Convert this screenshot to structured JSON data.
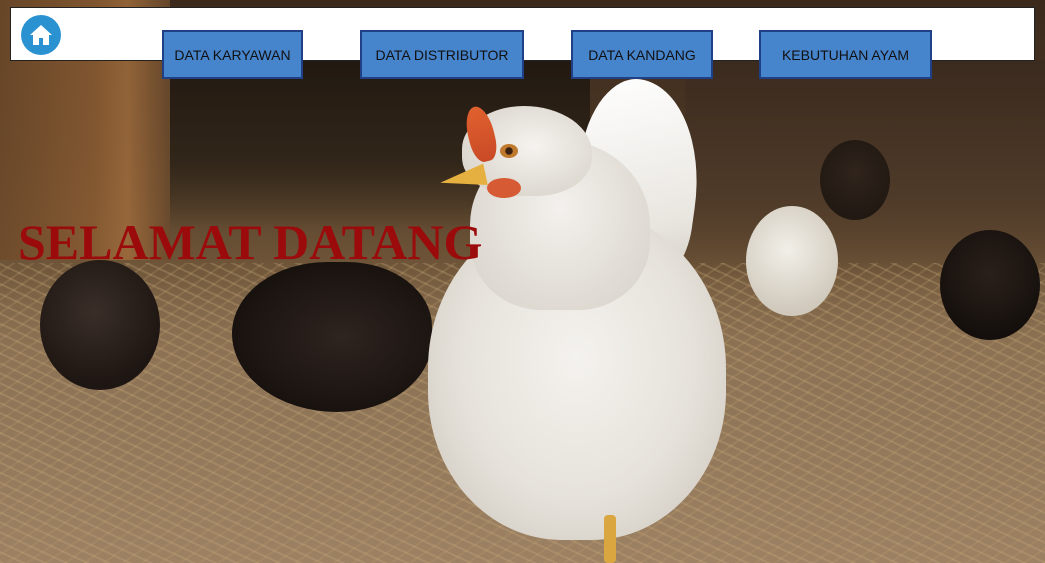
{
  "nav": {
    "home_icon": "home-icon",
    "items": [
      {
        "label": "DATA KARYAWAN"
      },
      {
        "label": "DATA DISTRIBUTOR"
      },
      {
        "label": "DATA KANDANG"
      },
      {
        "label": "KEBUTUHAN AYAM"
      }
    ]
  },
  "main": {
    "welcome_text": "SELAMAT DATANG"
  },
  "colors": {
    "nav_button_bg": "#4684cc",
    "nav_button_border": "#1f3f87",
    "home_icon_bg": "#2b92d2",
    "welcome_text": "#9b0b0b"
  }
}
